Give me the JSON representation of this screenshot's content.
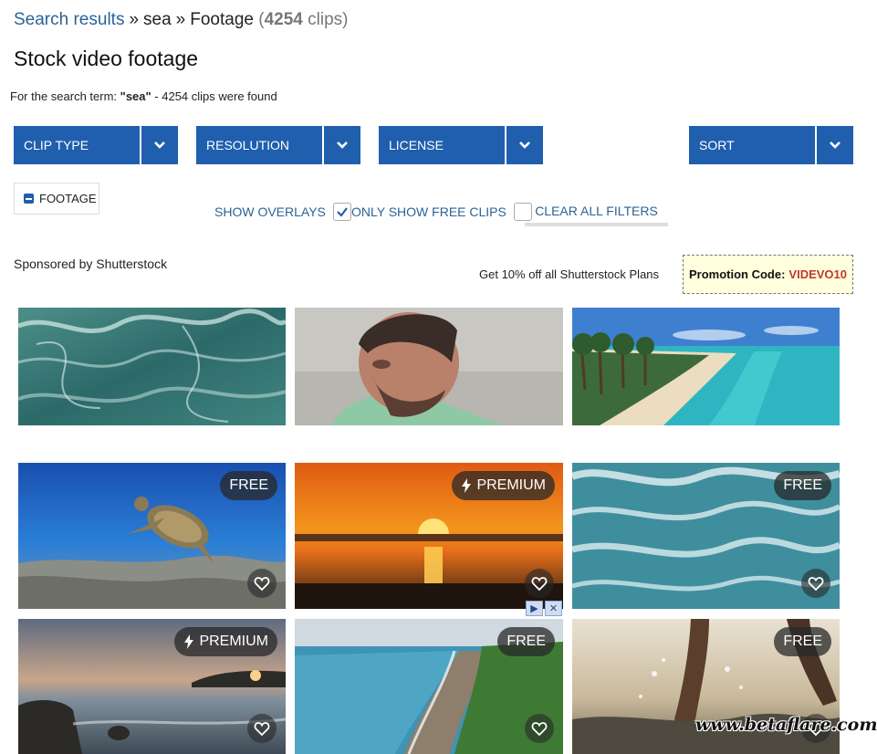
{
  "breadcrumb": {
    "search_results": "Search results",
    "sep1": "»",
    "term": "sea",
    "sep2": "»",
    "category": "Footage",
    "count_open": "(",
    "count_num": "4254",
    "count_label": " clips)"
  },
  "page_title": "Stock video footage",
  "search_summary": {
    "prefix": "For the search term: ",
    "term": "\"sea\"",
    "suffix": " - 4254 clips were found"
  },
  "filters": {
    "clip_type": "CLIP TYPE",
    "resolution": "RESOLUTION",
    "license": "LICENSE",
    "sort": "SORT"
  },
  "active_filter_chip": "FOOTAGE",
  "options": {
    "show_overlays": "SHOW OVERLAYS",
    "show_overlays_checked": true,
    "only_free": "ONLY SHOW FREE CLIPS",
    "only_free_checked": false,
    "clear_all": "CLEAR ALL FILTERS"
  },
  "sponsor": {
    "label": "Sponsored by Shutterstock",
    "offer": "Get 10% off all Shutterstock Plans",
    "promo_label": "Promotion Code:",
    "promo_code": "VIDEVO10"
  },
  "sponsored_clips": [
    {
      "icon": "ocean-waves-aerial"
    },
    {
      "icon": "laughing-man"
    },
    {
      "icon": "tropical-beach-resort"
    }
  ],
  "clips": [
    {
      "badge": "FREE",
      "icon": "sea-turtle-underwater"
    },
    {
      "badge": "PREMIUM",
      "icon": "ocean-sunset"
    },
    {
      "badge": "FREE",
      "icon": "rough-sea-waves"
    },
    {
      "badge": "PREMIUM",
      "icon": "rocky-coast-sunset"
    },
    {
      "badge": "FREE",
      "icon": "aerial-coastline"
    },
    {
      "badge": "FREE",
      "icon": "feet-splashing-water"
    }
  ],
  "watermark": "www.betaflare.com",
  "colors": {
    "accent": "#1f5fad",
    "link": "#2a6496",
    "promo_code": "#c0392b",
    "promo_bg": "#ffffdd"
  }
}
